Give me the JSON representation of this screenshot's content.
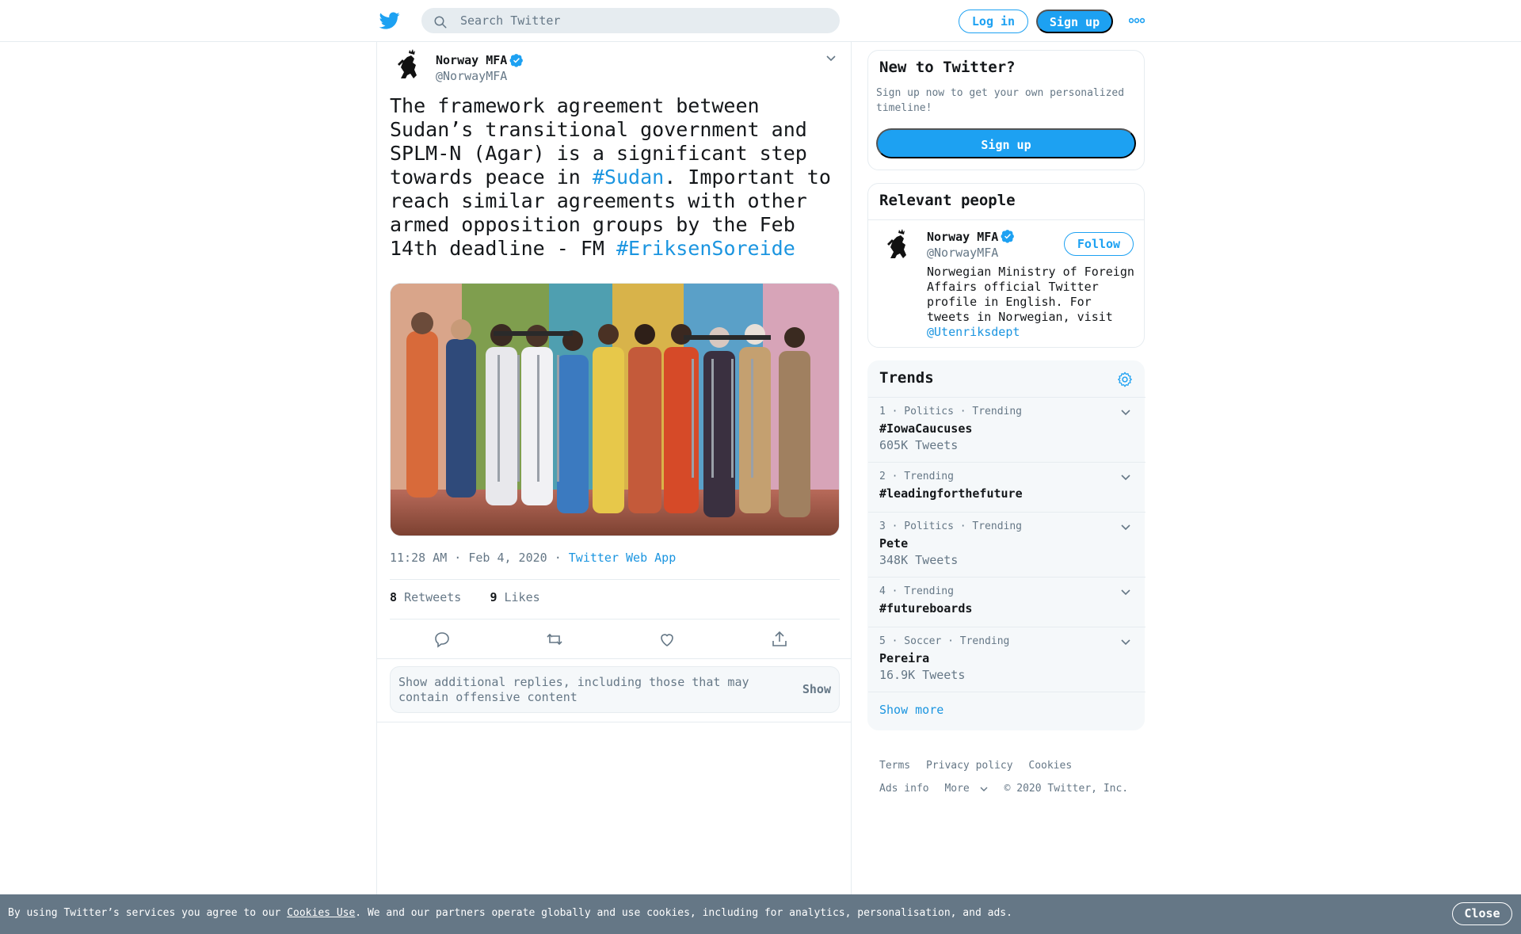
{
  "header": {
    "logo_icon": "twitter-bird-icon",
    "search_placeholder": "Search Twitter",
    "login_label": "Log in",
    "signup_label": "Sign up",
    "more_icon": "more-dots-icon"
  },
  "tweet": {
    "author_name": "Norway MFA",
    "author_handle": "@NorwayMFA",
    "text_part1": "The framework agreement between Sudan’s transitional government and SPLM-N (Agar) is a significant step towards peace in ",
    "hashtag1": "#Sudan",
    "text_part2": ". Important to reach similar agreements with other armed opposition groups by the Feb 14th deadline - FM ",
    "hashtag2": "#EriksenSoreide",
    "time": "11:28 AM · Feb 4, 2020",
    "separator": " · ",
    "source": "Twitter Web App",
    "retweets_count": "8",
    "retweets_label": "Retweets",
    "likes_count": "9",
    "likes_label": "Likes",
    "offensive_text": "Show additional replies, including those that may contain offensive content",
    "offensive_show": "Show"
  },
  "signup_card": {
    "title": "New to Twitter?",
    "description": "Sign up now to get your own personalized timeline!",
    "button": "Sign up"
  },
  "relevant_people": {
    "title": "Relevant people",
    "name": "Norway MFA",
    "handle": "@NorwayMFA",
    "follow_label": "Follow",
    "bio": "Norwegian Ministry of Foreign Affairs official Twitter profile in English. For tweets in Norwegian, visit ",
    "bio_mention": "@Utenriksdept"
  },
  "trends": {
    "title": "Trends",
    "items": [
      {
        "meta": "1 · Politics · Trending",
        "name": "#IowaCaucuses",
        "count": "605K Tweets"
      },
      {
        "meta": "2 · Trending",
        "name": "#leadingforthefuture",
        "count": ""
      },
      {
        "meta": "3 · Politics · Trending",
        "name": "Pete",
        "count": "348K Tweets"
      },
      {
        "meta": "4 · Trending",
        "name": "#futureboards",
        "count": ""
      },
      {
        "meta": "5 · Soccer · Trending",
        "name": "Pereira",
        "count": "16.9K Tweets"
      }
    ],
    "show_more": "Show more"
  },
  "footer": {
    "terms": "Terms",
    "privacy": "Privacy policy",
    "cookies": "Cookies",
    "ads_info": "Ads info",
    "more": "More",
    "copyright": "© 2020 Twitter, Inc."
  },
  "cookie_bar": {
    "text_before": "By using Twitter’s services you agree to our ",
    "link": "Cookies Use",
    "text_after": ". We and our partners operate globally and use cookies, including for analytics, personalisation, and ads.",
    "close": "Close"
  },
  "colors": {
    "accent": "#1da1f2",
    "link": "#1b95e0",
    "muted": "#657786",
    "cookie_bar": "#657786"
  }
}
